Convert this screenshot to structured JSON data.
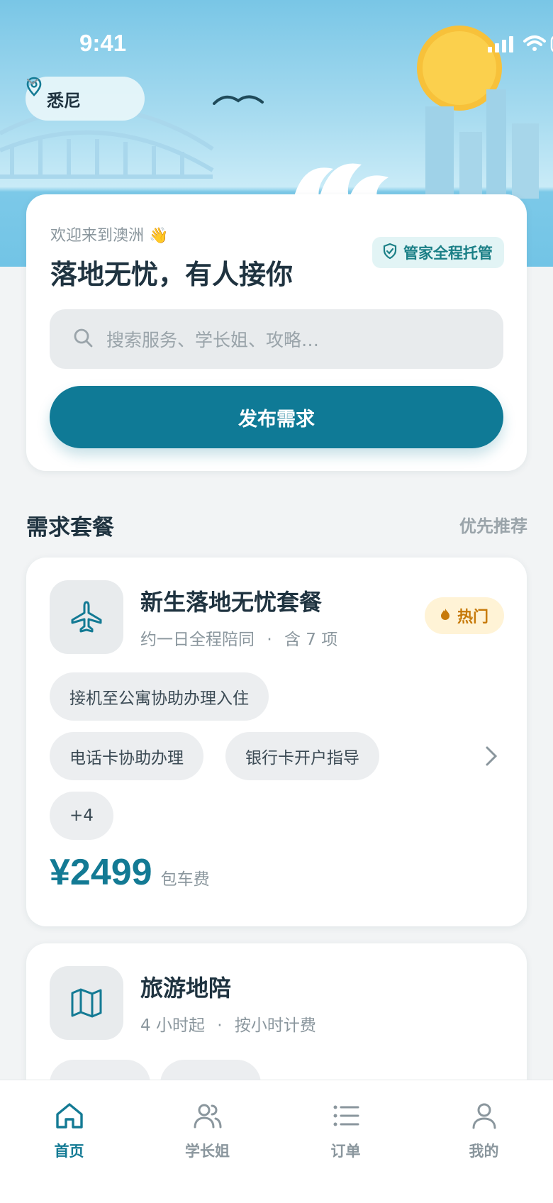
{
  "status_bar": {
    "time": "9:41"
  },
  "header": {
    "city": "悉尼"
  },
  "welcome": {
    "subtitle": "欢迎来到澳洲 👋",
    "title": "落地无忧，有人接你",
    "badge": "管家全程托管",
    "search_placeholder": "搜索服务、学长姐、攻略…",
    "publish_button": "发布需求"
  },
  "section": {
    "title": "需求套餐",
    "link": "优先推荐"
  },
  "packages": [
    {
      "name": "新生落地无忧套餐",
      "meta_a": "约一日全程陪同",
      "meta_b": "含 7 项",
      "badge": "热门",
      "tags": [
        "接机至公寓协助办理入住",
        "电话卡协助办理",
        "银行卡开户指导",
        "+4"
      ],
      "price": "¥2499",
      "price_unit": "包车费",
      "icon": "airplane-icon"
    },
    {
      "name": "旅游地陪",
      "meta_a": "4 小时起",
      "meta_b": "按小时计费",
      "icon": "map-icon"
    }
  ],
  "tabs": [
    {
      "label": "首页",
      "icon": "home-icon",
      "active": true
    },
    {
      "label": "学长姐",
      "icon": "users-icon",
      "active": false
    },
    {
      "label": "订单",
      "icon": "list-icon",
      "active": false
    },
    {
      "label": "我的",
      "icon": "user-icon",
      "active": false
    }
  ],
  "colors": {
    "accent": "#0f7a96",
    "hot": "#c77a0a",
    "sky": "#79c6e6"
  }
}
